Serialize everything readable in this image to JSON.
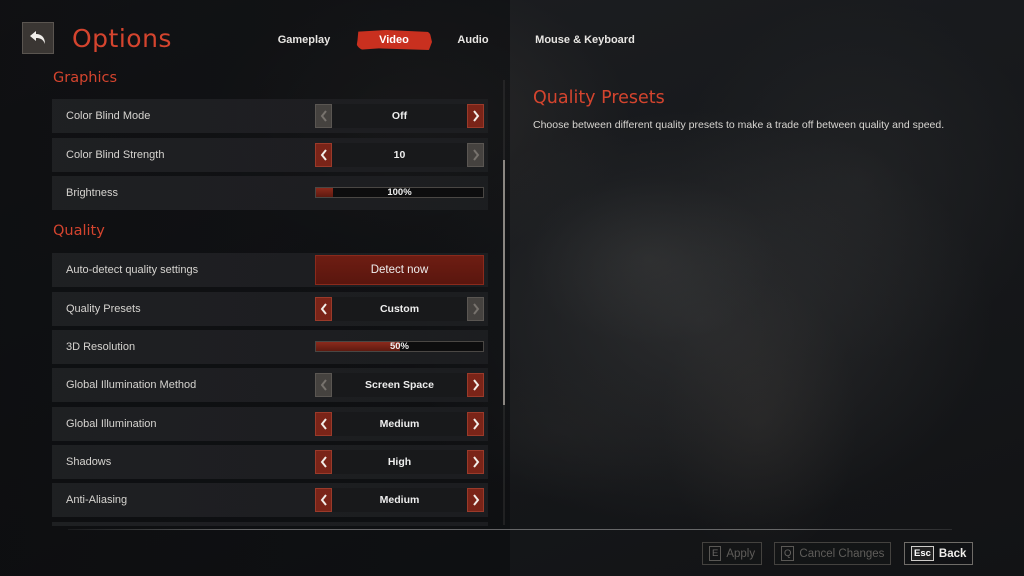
{
  "header": {
    "title": "Options",
    "tabs": [
      {
        "label": "Gameplay",
        "active": false
      },
      {
        "label": "Video",
        "active": true
      },
      {
        "label": "Audio",
        "active": false
      },
      {
        "label": "Mouse & Keyboard",
        "active": false
      }
    ]
  },
  "settings": {
    "section_graphics": "Graphics",
    "color_blind_mode": {
      "label": "Color Blind Mode",
      "value": "Off"
    },
    "color_blind_strength": {
      "label": "Color Blind Strength",
      "value": "10"
    },
    "brightness": {
      "label": "Brightness",
      "value_text": "100%",
      "fraction": 0.1
    },
    "section_quality": "Quality",
    "auto_detect": {
      "label": "Auto-detect quality settings",
      "button": "Detect now"
    },
    "quality_presets": {
      "label": "Quality Presets",
      "value": "Custom"
    },
    "resolution_3d": {
      "label": "3D Resolution",
      "value_text": "50%",
      "fraction": 0.5
    },
    "gi_method": {
      "label": "Global Illumination Method",
      "value": "Screen Space"
    },
    "global_illumination": {
      "label": "Global Illumination",
      "value": "Medium"
    },
    "shadows": {
      "label": "Shadows",
      "value": "High"
    },
    "anti_aliasing": {
      "label": "Anti-Aliasing",
      "value": "Medium"
    }
  },
  "info": {
    "title": "Quality Presets",
    "description": "Choose between different quality presets to make a trade off between quality and speed."
  },
  "footer": {
    "apply": {
      "key": "E",
      "label": "Apply"
    },
    "cancel": {
      "key": "Q",
      "label": "Cancel Changes"
    },
    "back": {
      "key": "Esc",
      "label": "Back"
    }
  },
  "colors": {
    "accent": "#d4442e",
    "active_tab": "#c9301f",
    "arrow_active": "#7a2418"
  }
}
